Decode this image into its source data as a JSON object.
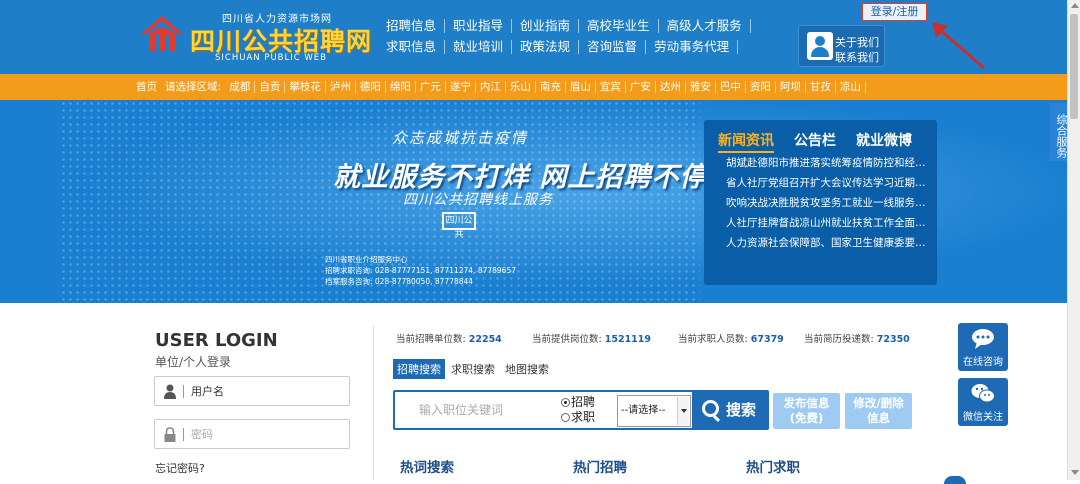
{
  "header": {
    "logo_top": "四川省人力资源市场网",
    "logo_main": "四川公共招聘网",
    "logo_en": "SICHUAN PUBLIC WEB",
    "nav_row1": [
      "招聘信息",
      "职业指导",
      "创业指南",
      "高校毕业生",
      "高级人才服务"
    ],
    "nav_row2": [
      "求职信息",
      "就业培训",
      "政策法规",
      "咨询监督",
      "劳动事务代理"
    ],
    "login_register": "登录/注册",
    "about_us": "关于我们",
    "contact_us": "联系我们"
  },
  "region_bar": {
    "home": "首页",
    "prompt": "请选择区域:",
    "regions": [
      "成都",
      "自贡",
      "攀枝花",
      "泸州",
      "德阳",
      "绵阳",
      "广元",
      "遂宁",
      "内江",
      "乐山",
      "南充",
      "眉山",
      "宜宾",
      "广安",
      "达州",
      "雅安",
      "巴中",
      "资阳",
      "阿坝",
      "甘孜",
      "凉山"
    ]
  },
  "banner": {
    "line1": "众志成城抗击疫情",
    "line2": "就业服务不打烊 网上招聘不停歇",
    "line3": "四川公共招聘线上服务",
    "stamp": "四川公共",
    "info1": "四川省职业介绍服务中心",
    "info2": "招聘求职咨询: 028-87777151, 87711274, 87789657",
    "info3": "档案服务咨询: 028-87780050, 87778844"
  },
  "news": {
    "tabs": [
      "新闻资讯",
      "公告栏",
      "就业微博"
    ],
    "items": [
      "胡斌赴德阳市推进落实统筹疫情防控和经济社会发展",
      "省人社厅党组召开扩大会议传达学习近期重要讲话",
      "吹响决战决胜脱贫攻坚务工就业一线服务冲锋号",
      "人社厅挂牌督战凉山州就业扶贫工作全面展开",
      "人力资源社会保障部、国家卫生健康委要求做好"
    ]
  },
  "side_tab": "综合服务",
  "login": {
    "title": "USER LOGIN",
    "subtitle": "单位/个人登录",
    "username_placeholder": "用户名",
    "password_placeholder": "密码",
    "forgot": "忘记密码?"
  },
  "stats": [
    {
      "label": "当前招聘单位数:",
      "value": "22254"
    },
    {
      "label": "当前提供岗位数:",
      "value": "1521119"
    },
    {
      "label": "当前求职人员数:",
      "value": "67379"
    },
    {
      "label": "当前简历投递数:",
      "value": "72350"
    }
  ],
  "search": {
    "tabs": [
      "招聘搜索",
      "求职搜索",
      "地图搜索"
    ],
    "placeholder": "输入职位关键词",
    "radio_recruit": "招聘",
    "radio_job": "求职",
    "select": "--请选择--",
    "button": "搜索"
  },
  "actions": {
    "publish_l1": "发布信息",
    "publish_l2": "(免费)",
    "modify_l1": "修改/删除",
    "modify_l2": "信息"
  },
  "hot": [
    "热词搜索",
    "热门招聘",
    "热门求职"
  ],
  "float": {
    "chat": "在线咨询",
    "wechat": "微信关注"
  },
  "colors": {
    "header_blue": "#1e7ec8",
    "region_orange": "#f39c1b",
    "accent_blue": "#1e6ab4",
    "news_active": "#ffb11a"
  }
}
